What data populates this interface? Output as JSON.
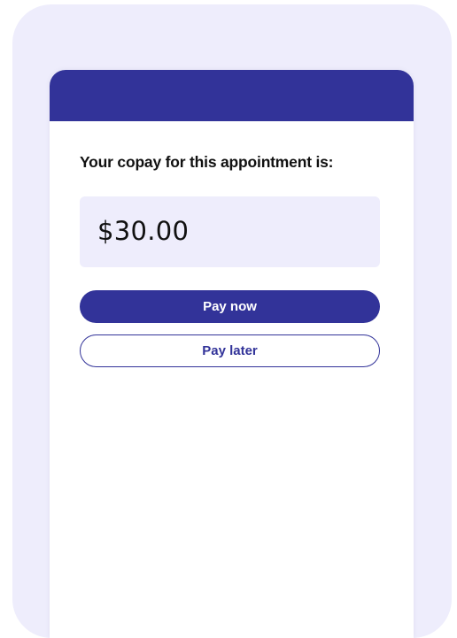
{
  "copay": {
    "prompt": "Your copay for this appointment is:",
    "amount": "$30.00"
  },
  "actions": {
    "pay_now_label": "Pay now",
    "pay_later_label": "Pay later"
  },
  "colors": {
    "brand": "#323399",
    "tint": "#eeedfc"
  }
}
